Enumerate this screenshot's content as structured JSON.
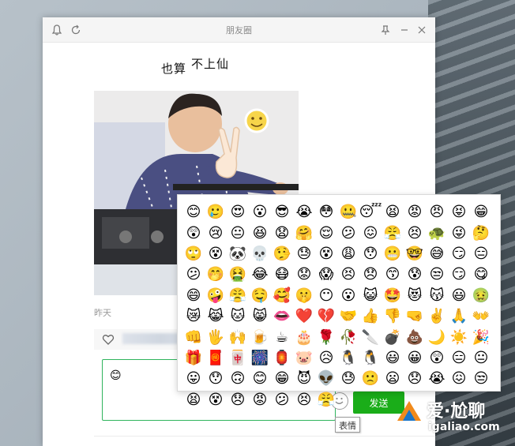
{
  "window": {
    "title": "朋友圈"
  },
  "titlebar": {
    "icons": [
      "bell-icon",
      "refresh-icon",
      "pin-icon",
      "minimize-icon",
      "close-icon"
    ]
  },
  "post": {
    "title_part1": "也算",
    "title_part2": "不上仙",
    "date": "昨天",
    "liker_suffix": "超"
  },
  "comment": {
    "current_value": "😊",
    "send_label": "发送",
    "emoji_tooltip": "表情"
  },
  "emoji_panel": {
    "emojis": [
      "😊",
      "🥲",
      "😍",
      "😮",
      "😎",
      "😭",
      "😳",
      "🤐",
      "😴",
      "😫",
      "😡",
      "😠",
      "😝",
      "😁",
      "😲",
      "😢",
      "😐",
      "😆",
      "😧",
      "🤗",
      "😌",
      "😕",
      "😖",
      "😤",
      "😣",
      "🐢",
      "😜",
      "🤔",
      "🙄",
      "😵",
      "🐼",
      "💀",
      "🤥",
      "😓",
      "😵",
      "😩",
      "😯",
      "😬",
      "🤓",
      "😅",
      "😏",
      "😑",
      "😕",
      "🤭",
      "🤮",
      "😂",
      "😷",
      "😟",
      "😱",
      "😣",
      "😞",
      "😙",
      "😰",
      "😒",
      "😏",
      "😋",
      "😄",
      "🤪",
      "😤",
      "🤤",
      "🥰",
      "🤫",
      "😶",
      "😮",
      "😺",
      "🤩",
      "😻",
      "😽",
      "😃",
      "🤢",
      "😿",
      "😹",
      "🐱",
      "😸",
      "👄",
      "❤️",
      "💔",
      "🤝",
      "👍",
      "👎",
      "🤜",
      "✌️",
      "🙏",
      "👐",
      "👊",
      "🖐️",
      "🙌",
      "🍺",
      "☕",
      "🎂",
      "🌹",
      "🥀",
      "🔪",
      "💣",
      "💩",
      "🌙",
      "☀️",
      "🎉",
      "🎁",
      "🧧",
      "🀄",
      "🎆",
      "🏮",
      "🐷",
      "😥",
      "🐧",
      "🐧",
      "😃",
      "😀",
      "😲",
      "😑",
      "😐",
      "😛",
      "😯",
      "🙃",
      "😊",
      "😁",
      "😈",
      "👽",
      "😓",
      "🙁",
      "😦",
      "😞",
      "😭",
      "😖",
      "😒",
      "😫",
      "😵",
      "😞",
      "😡",
      "😕",
      "😣",
      "😤"
    ]
  },
  "watermark": {
    "brand": "爱·尬聊",
    "domain": "igaliao.com"
  },
  "colors": {
    "accent_green": "#1aad19",
    "link_blue": "#576b95",
    "border_green": "#2fb45d"
  }
}
